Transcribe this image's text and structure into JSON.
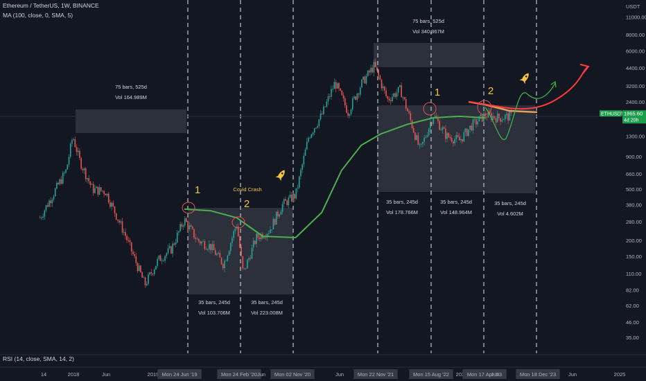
{
  "header": {
    "symbol_line": "Ethereum / TetherUS, 1W, BINANCE",
    "indicator_line": "MA (100, close, 0, SMA, 5)",
    "rsi_line": "RSI (14, close, SMA, 14, 2)"
  },
  "price_axis": {
    "currency": "USDT",
    "ticks": [
      "11000.00",
      "8000.00",
      "6000.00",
      "4400.00",
      "3200.00",
      "2400.00",
      "1800.00",
      "1300.00",
      "900.00",
      "660.00",
      "500.00",
      "380.00",
      "280.00",
      "200.00",
      "150.00",
      "110.00",
      "82.00",
      "62.00",
      "46.00",
      "35.00"
    ],
    "last_price_label": "ETHUSDT",
    "last_price": "1865.60",
    "countdown": "4d 20h",
    "accent_green": "#1b9e4b"
  },
  "time_axis": {
    "ticks": [
      "14",
      "2018",
      "Jun",
      "2019",
      "Mon 24 Jun '19",
      "Mon 24 Feb '20",
      "Jun",
      "Mon 02 Nov '20",
      "Jun",
      "Mon 22 Nov '21",
      "Mon 15 Aug '22",
      "2023",
      "Mon 17 Apr '23",
      "Jun",
      "Mon 18 Dec '23",
      "Jun",
      "2025"
    ]
  },
  "colors": {
    "up": "#26a69a",
    "down": "#ef5350",
    "ma": "#4caf50",
    "annot_yellow": "#f5c542",
    "projection_red": "#ff3b3b",
    "projection_orange": "#e0a060",
    "projection_green": "#3fb950",
    "box_fill": "#363a45",
    "circle": "#e25555"
  },
  "annotations": {
    "covid": "Covid Crash",
    "cycle_numbers": [
      "1",
      "2",
      "1",
      "2"
    ],
    "rocket_icon": "rocket-icon",
    "boxes": [
      {
        "bars": "75 bars, 525d",
        "vol": "Vol 164.989M"
      },
      {
        "bars": "35 bars, 245d",
        "vol": "Vol 103.706M"
      },
      {
        "bars": "35 bars, 245d",
        "vol": "Vol 223.008M"
      },
      {
        "bars": "75 bars, 525d",
        "vol": "Vol 340.367M"
      },
      {
        "bars": "35 bars, 245d",
        "vol": "Vol 178.766M"
      },
      {
        "bars": "35 bars, 245d",
        "vol": "Vol 148.964M"
      },
      {
        "bars": "35 bars, 245d",
        "vol": "Vol 4.602M"
      }
    ]
  },
  "chart_data": {
    "type": "candlestick",
    "scale": "log",
    "symbol": "ETHUSDT",
    "timeframe": "1W",
    "exchange": "BINANCE",
    "x_range": [
      "2017-08",
      "2025-01"
    ],
    "ylim": [
      35,
      11000
    ],
    "grid": false,
    "series": [
      {
        "name": "ETHUSDT",
        "dates": [
          "2017-08",
          "2017-12",
          "2018-01",
          "2018-02",
          "2018-04",
          "2018-06",
          "2018-09",
          "2018-12",
          "2019-02",
          "2019-04",
          "2019-06",
          "2019-08",
          "2019-10",
          "2019-12",
          "2020-02",
          "2020-03",
          "2020-05",
          "2020-07",
          "2020-09",
          "2020-11",
          "2021-01",
          "2021-03",
          "2021-05",
          "2021-07",
          "2021-09",
          "2021-11",
          "2022-01",
          "2022-03",
          "2022-06",
          "2022-08",
          "2022-10",
          "2022-12",
          "2023-02",
          "2023-04",
          "2023-06",
          "2023-08"
        ],
        "values": [
          300,
          700,
          1300,
          850,
          500,
          480,
          220,
          90,
          140,
          170,
          290,
          200,
          180,
          130,
          270,
          110,
          210,
          240,
          380,
          450,
          1300,
          1900,
          3400,
          2000,
          3300,
          4600,
          2500,
          3000,
          1000,
          1900,
          1300,
          1200,
          1600,
          1900,
          1800,
          1865.6
        ]
      },
      {
        "name": "MA (100, close, 0, SMA, 5)",
        "dates": [
          "2019-06",
          "2019-10",
          "2020-02",
          "2020-06",
          "2020-11",
          "2021-03",
          "2021-06",
          "2021-09",
          "2021-12",
          "2022-04",
          "2022-08",
          "2022-12",
          "2023-04"
        ],
        "values": [
          350,
          340,
          300,
          215,
          210,
          330,
          700,
          1100,
          1350,
          1600,
          1800,
          1850,
          1800
        ]
      }
    ],
    "cycles": [
      {
        "label": "75 bars, 525d",
        "volume": "Vol 164.989M",
        "start": "2017-12",
        "end": "2019-06"
      },
      {
        "label": "35 bars, 245d",
        "volume": "Vol 103.706M",
        "start": "2019-06",
        "end": "2020-02"
      },
      {
        "label": "35 bars, 245d",
        "volume": "Vol 223.008M",
        "start": "2020-02",
        "end": "2020-11"
      },
      {
        "label": "75 bars, 525d",
        "volume": "Vol 340.367M",
        "start": "2021-11",
        "end": "2023-04"
      },
      {
        "label": "35 bars, 245d",
        "volume": "Vol 178.766M",
        "start": "2021-11",
        "end": "2022-08"
      },
      {
        "label": "35 bars, 245d",
        "volume": "Vol 148.964M",
        "start": "2022-08",
        "end": "2023-04"
      },
      {
        "label": "35 bars, 245d",
        "volume": "Vol 4.602M",
        "start": "2023-04",
        "end": "2023-12"
      }
    ]
  }
}
